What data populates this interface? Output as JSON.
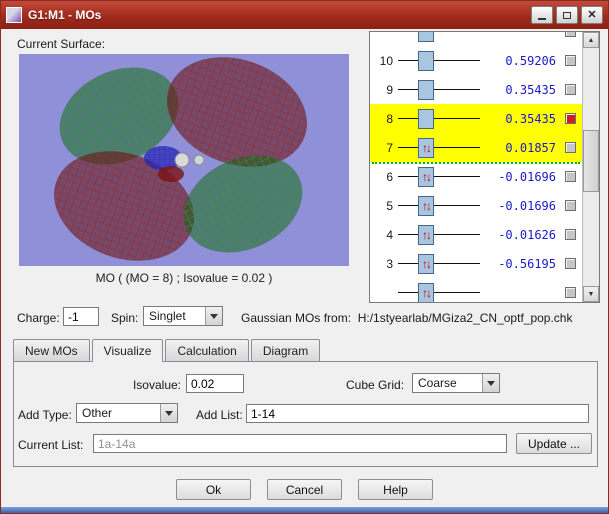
{
  "window": {
    "title": "G1:M1 - MOs"
  },
  "surface": {
    "label": "Current Surface:",
    "caption": "MO ( (MO = 8) ; Isovalue = 0.02 )"
  },
  "mo_list": {
    "rows": [
      {
        "num": "",
        "energy": "",
        "occupied": false,
        "selected": false
      },
      {
        "num": "10",
        "energy": "0.59206",
        "occupied": false,
        "selected": false
      },
      {
        "num": "9",
        "energy": "0.35435",
        "occupied": false,
        "selected": false
      },
      {
        "num": "8",
        "energy": "0.35435",
        "occupied": false,
        "selected": true
      },
      {
        "num": "7",
        "energy": "0.01857",
        "occupied": true,
        "selected": true
      },
      {
        "num": "6",
        "energy": "-0.01696",
        "occupied": true,
        "selected": false
      },
      {
        "num": "5",
        "energy": "-0.01696",
        "occupied": true,
        "selected": false
      },
      {
        "num": "4",
        "energy": "-0.01626",
        "occupied": true,
        "selected": false
      },
      {
        "num": "3",
        "energy": "-0.56195",
        "occupied": true,
        "selected": false
      },
      {
        "num": "",
        "energy": "",
        "occupied": true,
        "selected": false
      }
    ]
  },
  "form": {
    "charge_label": "Charge:",
    "charge_value": "-1",
    "spin_label": "Spin:",
    "spin_value": "Singlet",
    "source_label": "Gaussian MOs from:",
    "source_path": "H:/1styearlab/MGiza2_CN_optf_pop.chk"
  },
  "tabs": {
    "items": [
      {
        "label": "New MOs"
      },
      {
        "label": "Visualize"
      },
      {
        "label": "Calculation"
      },
      {
        "label": "Diagram"
      }
    ]
  },
  "visualize": {
    "isovalue_label": "Isovalue:",
    "isovalue_value": "0.02",
    "cube_grid_label": "Cube Grid:",
    "cube_grid_value": "Coarse",
    "add_type_label": "Add Type:",
    "add_type_value": "Other",
    "add_list_label": "Add List:",
    "add_list_value": "1-14",
    "current_list_label": "Current List:",
    "current_list_value": "1a-14a",
    "update_button": "Update ..."
  },
  "actions": {
    "ok": "Ok",
    "cancel": "Cancel",
    "help": "Help"
  },
  "colors": {
    "titlebar": "#a02a1c",
    "selection_highlight": "#ffff00",
    "energy_text": "#1a1ac8",
    "surface_background": "#8f90d8",
    "homo_lumo_separator": "#00bb00",
    "selected_checkbox": "#cc2020"
  }
}
